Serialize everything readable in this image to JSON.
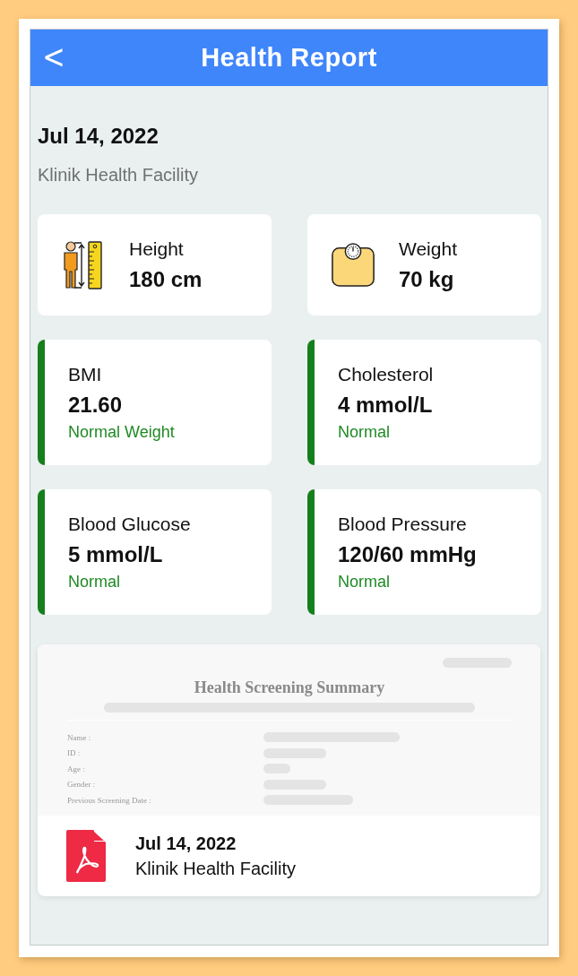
{
  "header": {
    "back": "<",
    "title": "Health Report"
  },
  "report": {
    "date": "Jul 14, 2022",
    "facility": "Klinik Health Facility"
  },
  "measurements": [
    {
      "kind": "height",
      "label": "Height",
      "value": "180 cm"
    },
    {
      "kind": "weight",
      "label": "Weight",
      "value": "70 kg"
    }
  ],
  "results": [
    {
      "label": "BMI",
      "value": "21.60",
      "status": "Normal Weight"
    },
    {
      "label": "Cholesterol",
      "value": "4 mmol/L",
      "status": "Normal"
    },
    {
      "label": "Blood Glucose",
      "value": "5 mmol/L",
      "status": "Normal"
    },
    {
      "label": "Blood Pressure",
      "value": "120/60 mmHg",
      "status": "Normal"
    }
  ],
  "document": {
    "preview_title": "Health Screening Summary",
    "preview_fields": [
      "Name :",
      "ID :",
      "Age :",
      "Gender :",
      "Previous Screening Date :"
    ],
    "date": "Jul 14, 2022",
    "facility": "Klinik Health Facility"
  }
}
